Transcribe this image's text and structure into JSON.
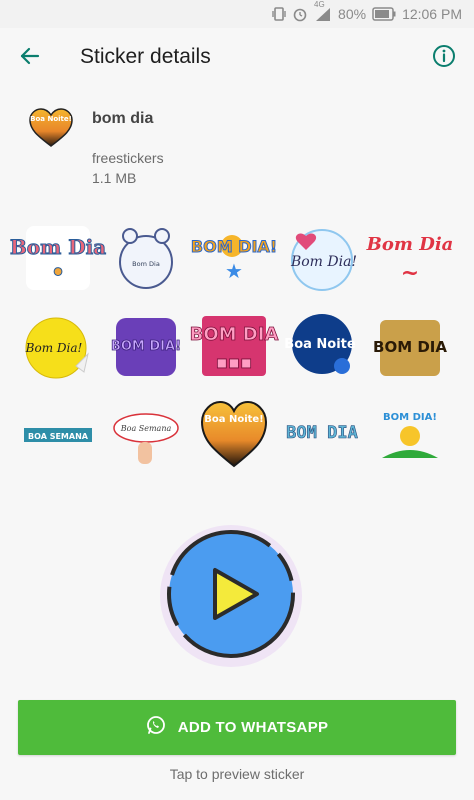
{
  "status_bar": {
    "battery_percent": "80%",
    "time": "12:06 PM",
    "network_label": "4G"
  },
  "app_bar": {
    "title": "Sticker details",
    "back_icon": "arrow-left-icon",
    "info_icon": "info-icon",
    "accent_color": "#0b7e6e"
  },
  "pack": {
    "name": "bom dia",
    "publisher": "freestickers",
    "size": "1.1 MB",
    "icon_text": "Boa Noite!"
  },
  "stickers": [
    {
      "text": "Bom Dia"
    },
    {
      "text": "Bom Dia"
    },
    {
      "text": "BOM DIA!"
    },
    {
      "text": "Bom Dia!"
    },
    {
      "text": "Bom Dia"
    },
    {
      "text": "Bom Dia!"
    },
    {
      "text": "BOM DIA!"
    },
    {
      "text": "BOM DIA"
    },
    {
      "text": "Boa Noite"
    },
    {
      "text": "BOM DIA"
    },
    {
      "text": "BOA SEMANA"
    },
    {
      "text": "Boa Semana"
    },
    {
      "text": "Boa Noite!"
    },
    {
      "text": "BOM DIA"
    },
    {
      "text": "BOM DIA!"
    }
  ],
  "play_button": {
    "icon": "play-icon",
    "fill_color": "#4b9cf0",
    "triangle_color": "#f4ea3b"
  },
  "add_button": {
    "label": "ADD TO WHATSAPP",
    "icon": "whatsapp-icon",
    "color": "#4fbb3b"
  },
  "hint_text": "Tap to preview sticker"
}
